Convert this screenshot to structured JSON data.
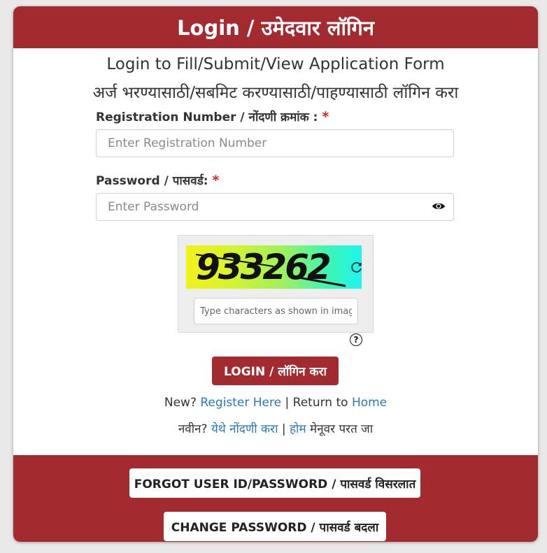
{
  "header": {
    "title": "Login / उमेदवार लॉगिन"
  },
  "subtitle": {
    "english": "Login to Fill/Submit/View Application Form",
    "marathi": "अर्ज भरण्यासाठी/सबमिट करण्यासाठी/पाहण्यासाठी लॉगिन करा"
  },
  "registration": {
    "label": "Registration Number / नोंदणी क्रमांक :",
    "required_mark": "*",
    "placeholder": "Enter Registration Number",
    "value": ""
  },
  "password": {
    "label": "Password / पासवर्ड:",
    "required_mark": "*",
    "placeholder": "Enter Password",
    "value": ""
  },
  "captcha": {
    "image_text": "933262",
    "placeholder": "Type characters as shown in image",
    "help_symbol": "?"
  },
  "login_button": {
    "label": "LOGIN / लॉगिन करा"
  },
  "links": {
    "new_text": "New?",
    "register_here": "Register Here",
    "separator": "|",
    "return_to": "Return to",
    "home": "Home",
    "marathi_new": "नवीन?",
    "marathi_register": "येथे नोंदणी करा",
    "marathi_separator": "|",
    "marathi_home": "होम",
    "marathi_return": "मेनूवर परत जा"
  },
  "footer": {
    "forgot_button": "FORGOT USER ID/PASSWORD / पासवर्ड विसरलात",
    "change_button": "CHANGE PASSWORD / पासवर्ड बदला"
  },
  "colors": {
    "brand": "#a32a2e",
    "link": "#2a78b8",
    "required": "#e0201b"
  },
  "icons": {
    "password_toggle": "eye-icon",
    "captcha_refresh": "refresh-icon",
    "captcha_help": "question-circle-icon"
  }
}
